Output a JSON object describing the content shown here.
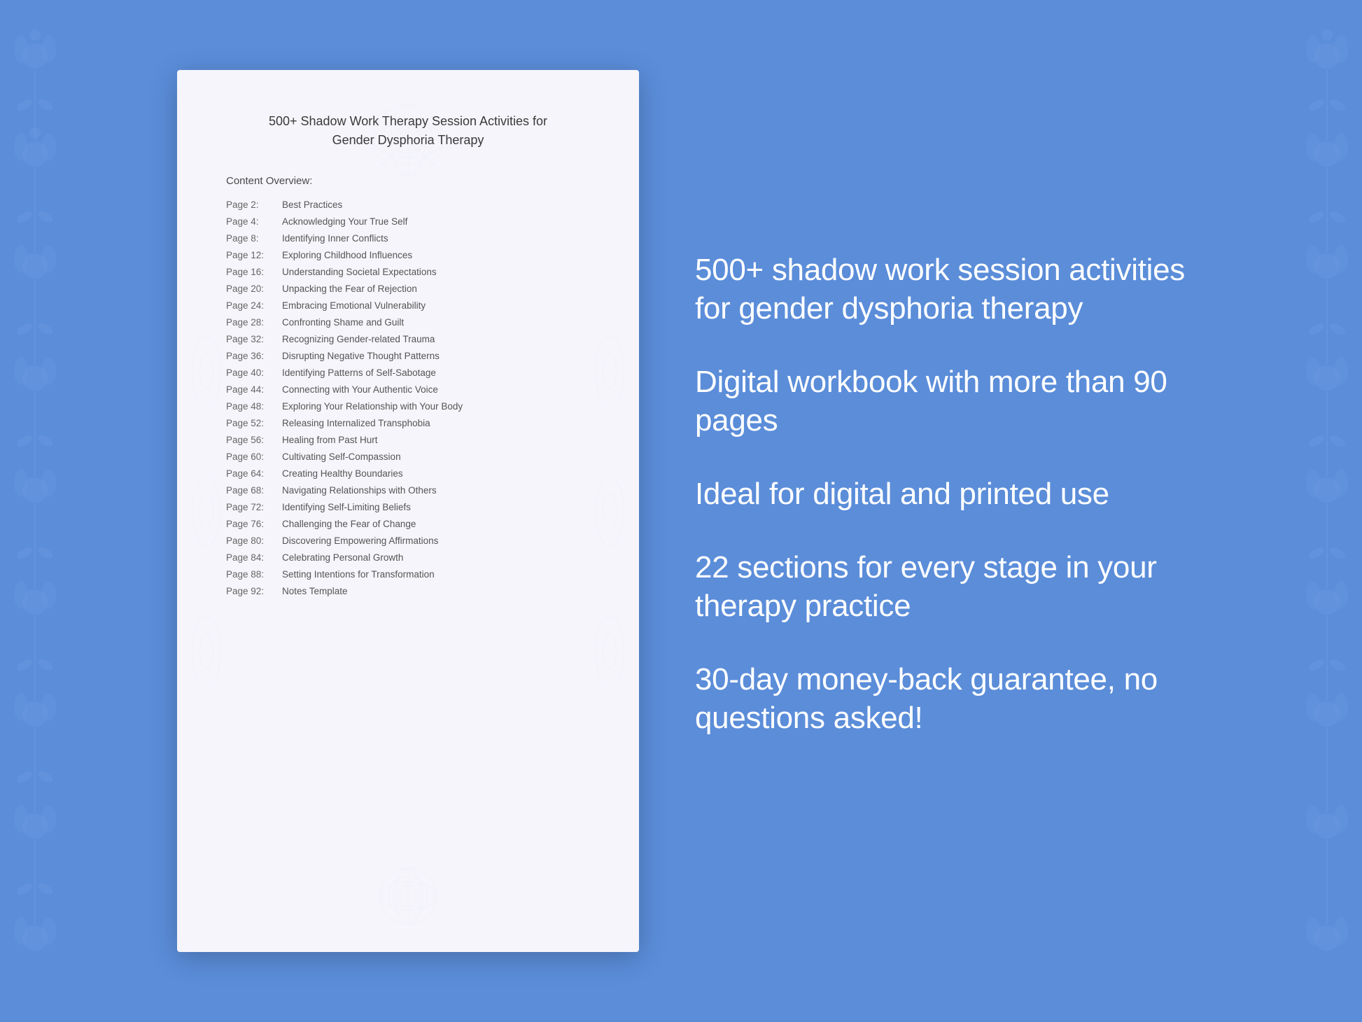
{
  "background_color": "#5b8dd9",
  "document": {
    "title_line1": "500+ Shadow Work Therapy Session Activities for",
    "title_line2": "Gender Dysphoria Therapy",
    "content_header": "Content Overview:",
    "toc": [
      {
        "page": "Page  2:",
        "title": "Best Practices"
      },
      {
        "page": "Page  4:",
        "title": "Acknowledging Your True Self"
      },
      {
        "page": "Page  8:",
        "title": "Identifying Inner Conflicts"
      },
      {
        "page": "Page 12:",
        "title": "Exploring Childhood Influences"
      },
      {
        "page": "Page 16:",
        "title": "Understanding Societal Expectations"
      },
      {
        "page": "Page 20:",
        "title": "Unpacking the Fear of Rejection"
      },
      {
        "page": "Page 24:",
        "title": "Embracing Emotional Vulnerability"
      },
      {
        "page": "Page 28:",
        "title": "Confronting Shame and Guilt"
      },
      {
        "page": "Page 32:",
        "title": "Recognizing Gender-related Trauma"
      },
      {
        "page": "Page 36:",
        "title": "Disrupting Negative Thought Patterns"
      },
      {
        "page": "Page 40:",
        "title": "Identifying Patterns of Self-Sabotage"
      },
      {
        "page": "Page 44:",
        "title": "Connecting with Your Authentic Voice"
      },
      {
        "page": "Page 48:",
        "title": "Exploring Your Relationship with Your Body"
      },
      {
        "page": "Page 52:",
        "title": "Releasing Internalized Transphobia"
      },
      {
        "page": "Page 56:",
        "title": "Healing from Past Hurt"
      },
      {
        "page": "Page 60:",
        "title": "Cultivating Self-Compassion"
      },
      {
        "page": "Page 64:",
        "title": "Creating Healthy Boundaries"
      },
      {
        "page": "Page 68:",
        "title": "Navigating Relationships with Others"
      },
      {
        "page": "Page 72:",
        "title": "Identifying Self-Limiting Beliefs"
      },
      {
        "page": "Page 76:",
        "title": "Challenging the Fear of Change"
      },
      {
        "page": "Page 80:",
        "title": "Discovering Empowering Affirmations"
      },
      {
        "page": "Page 84:",
        "title": "Celebrating Personal Growth"
      },
      {
        "page": "Page 88:",
        "title": "Setting Intentions for Transformation"
      },
      {
        "page": "Page 92:",
        "title": "Notes Template"
      }
    ]
  },
  "promo": {
    "items": [
      {
        "text": "500+ shadow work session activities for gender dysphoria therapy"
      },
      {
        "text": "Digital workbook with more than 90 pages"
      },
      {
        "text": "Ideal for digital and printed use"
      },
      {
        "text": "22 sections for every stage in your therapy practice"
      },
      {
        "text": "30-day money-back guarantee, no questions asked!"
      }
    ]
  },
  "floral": {
    "sprigs": [
      "❀",
      "✿",
      "❁",
      "✾",
      "❀",
      "✿",
      "❁",
      "✾",
      "❀",
      "✿",
      "❁"
    ]
  }
}
